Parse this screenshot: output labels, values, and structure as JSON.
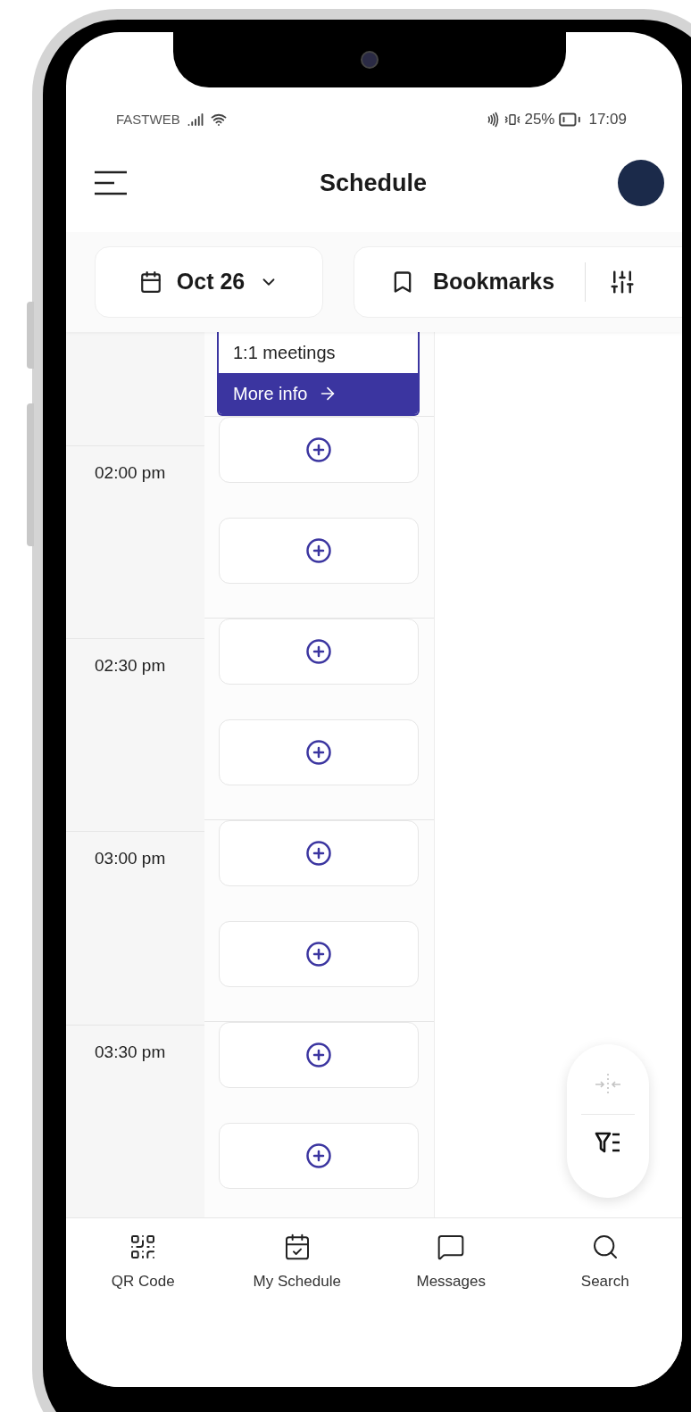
{
  "status_bar": {
    "carrier": "FASTWEB",
    "battery": "25%",
    "time": "17:09"
  },
  "header": {
    "title": "Schedule"
  },
  "filters": {
    "date": "Oct 26",
    "bookmarks": "Bookmarks"
  },
  "event_card": {
    "title": "1:1 meetings",
    "link": "More info"
  },
  "time_slots": [
    {
      "time": "02:00 pm"
    },
    {
      "time": "02:30 pm"
    },
    {
      "time": "03:00 pm"
    },
    {
      "time": "03:30 pm"
    }
  ],
  "fab": {
    "collapse_disabled": true
  },
  "bottom_nav": [
    {
      "kind": "qr",
      "label": "QR Code"
    },
    {
      "kind": "schedule",
      "label": "My Schedule"
    },
    {
      "kind": "messages",
      "label": "Messages"
    },
    {
      "kind": "search",
      "label": "Search"
    }
  ]
}
